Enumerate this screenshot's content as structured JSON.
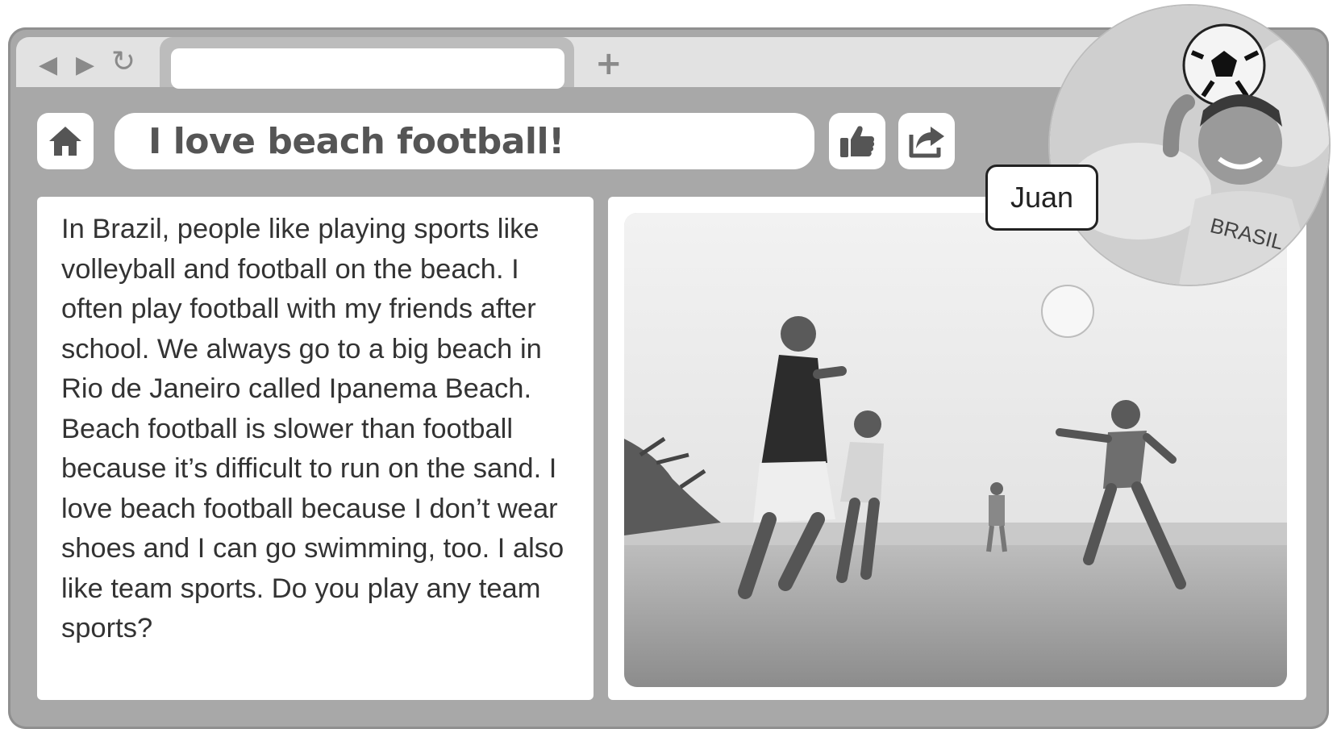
{
  "browser": {
    "back_icon": "back-arrow-icon",
    "forward_icon": "forward-arrow-icon",
    "reload_icon": "reload-icon",
    "address_value": "",
    "new_tab_label": "+"
  },
  "toolbar": {
    "home_icon": "home-icon",
    "page_title": "I love beach football!",
    "like_icon": "thumbs-up-icon",
    "share_icon": "share-icon"
  },
  "post": {
    "body": "In Brazil, people like playing sports like volleyball and football on the beach. I often play football with my friends after school. We always go to a big beach in Rio de Janeiro called Ipanema Beach. Beach football is slower than football because it’s difficult to run on the sand. I love beach football because I don’t wear shoes and I can go swimming, too. I also like team sports. Do you play any team sports?",
    "photo_alt": "boys-playing-beach-football-photo"
  },
  "author": {
    "name": "Juan",
    "shirt_text": "BRASIL"
  },
  "colors": {
    "frame": "#a8a8a8",
    "tabbar": "#e2e2e2",
    "panel": "#ffffff",
    "text": "#333333"
  }
}
